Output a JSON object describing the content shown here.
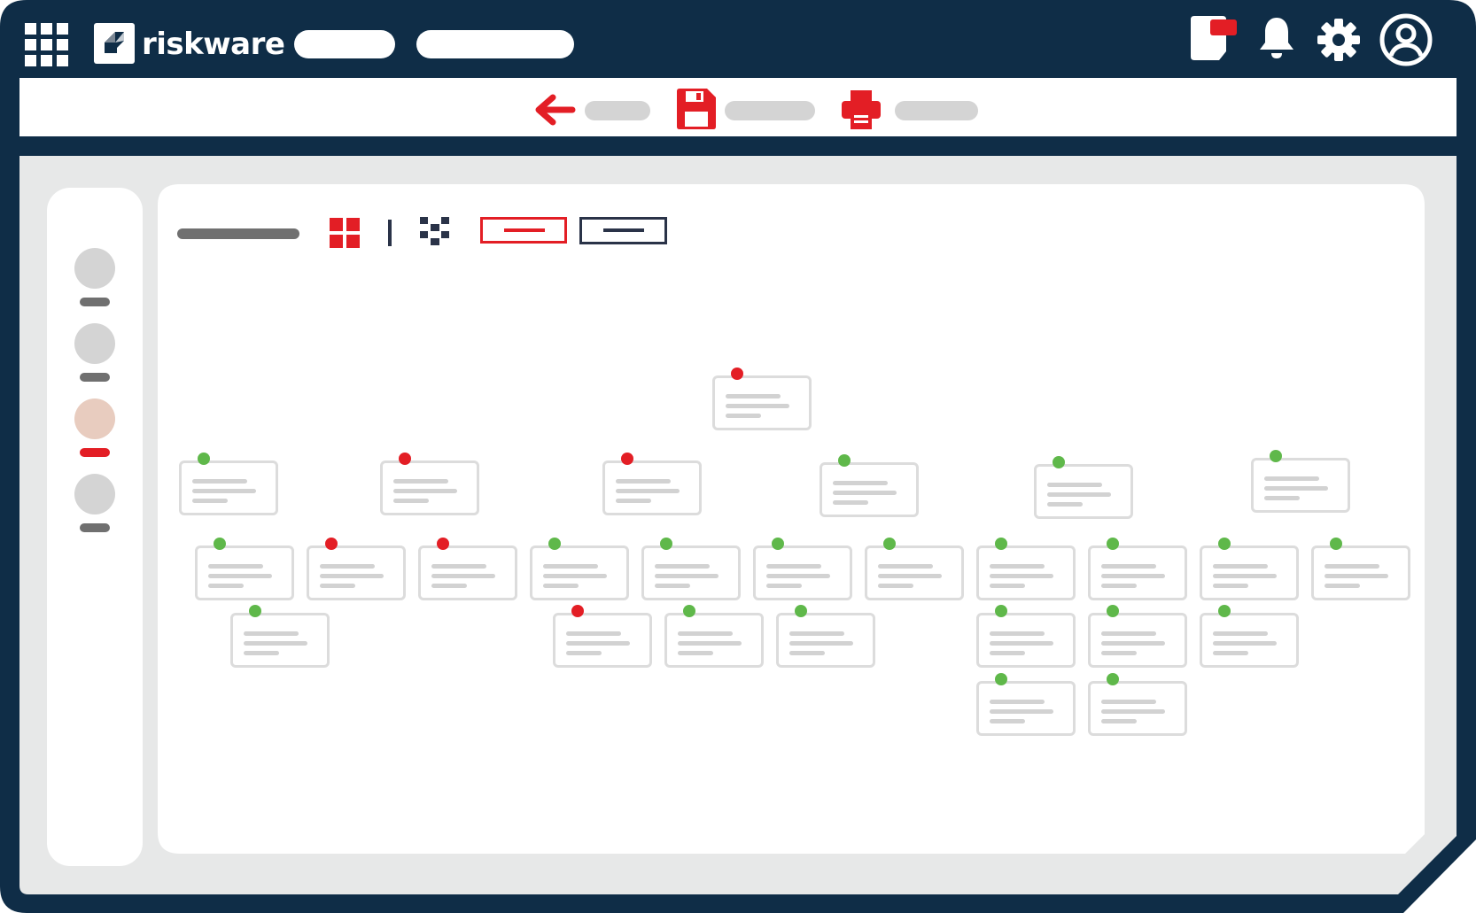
{
  "brand": {
    "name": "riskware"
  },
  "colors": {
    "frame": "#0f2d47",
    "accent_red": "#e31e25",
    "status_green": "#5fb84a",
    "status_red": "#e31e25",
    "panel_bg": "#e7e8e8",
    "placeholder_gray": "#d2d2d2"
  },
  "header": {
    "icons": [
      "apps-grid-icon",
      "notes-icon",
      "bell-icon",
      "gear-icon",
      "user-icon"
    ]
  },
  "toolbar": {
    "icons": [
      "back-arrow-icon",
      "save-icon",
      "print-icon"
    ]
  },
  "sidebar": {
    "items": [
      {
        "name": "nav-item-1",
        "active": false
      },
      {
        "name": "nav-item-2",
        "active": false
      },
      {
        "name": "nav-item-3",
        "active": true
      },
      {
        "name": "nav-item-4",
        "active": false
      }
    ]
  },
  "view_controls": {
    "icons": [
      "grid-view-icon",
      "divider-bar",
      "checker-view-icon"
    ],
    "buttons": [
      "view-button-primary",
      "view-button-secondary"
    ]
  },
  "org_chart": {
    "nodes": [
      {
        "id": "root",
        "status": "red"
      },
      {
        "id": "l1-1",
        "status": "green"
      },
      {
        "id": "l1-2",
        "status": "red"
      },
      {
        "id": "l1-3",
        "status": "red"
      },
      {
        "id": "l1-4",
        "status": "green"
      },
      {
        "id": "l1-5",
        "status": "green"
      },
      {
        "id": "l1-6",
        "status": "green"
      },
      {
        "id": "l2-1",
        "status": "green"
      },
      {
        "id": "l2-2",
        "status": "red"
      },
      {
        "id": "l2-3",
        "status": "red"
      },
      {
        "id": "l2-4",
        "status": "green"
      },
      {
        "id": "l2-5",
        "status": "green"
      },
      {
        "id": "l2-6",
        "status": "green"
      },
      {
        "id": "l2-7",
        "status": "green"
      },
      {
        "id": "l2-8",
        "status": "green"
      },
      {
        "id": "l2-9",
        "status": "green"
      },
      {
        "id": "l2-10",
        "status": "green"
      },
      {
        "id": "l2-11",
        "status": "green"
      },
      {
        "id": "l3-1",
        "status": "green"
      },
      {
        "id": "l3-2",
        "status": "red"
      },
      {
        "id": "l3-3",
        "status": "green"
      },
      {
        "id": "l3-4",
        "status": "green"
      },
      {
        "id": "l3-5",
        "status": "green"
      },
      {
        "id": "l3-6",
        "status": "green"
      },
      {
        "id": "l3-7",
        "status": "green"
      },
      {
        "id": "l4-1",
        "status": "green"
      },
      {
        "id": "l4-2",
        "status": "green"
      }
    ]
  }
}
